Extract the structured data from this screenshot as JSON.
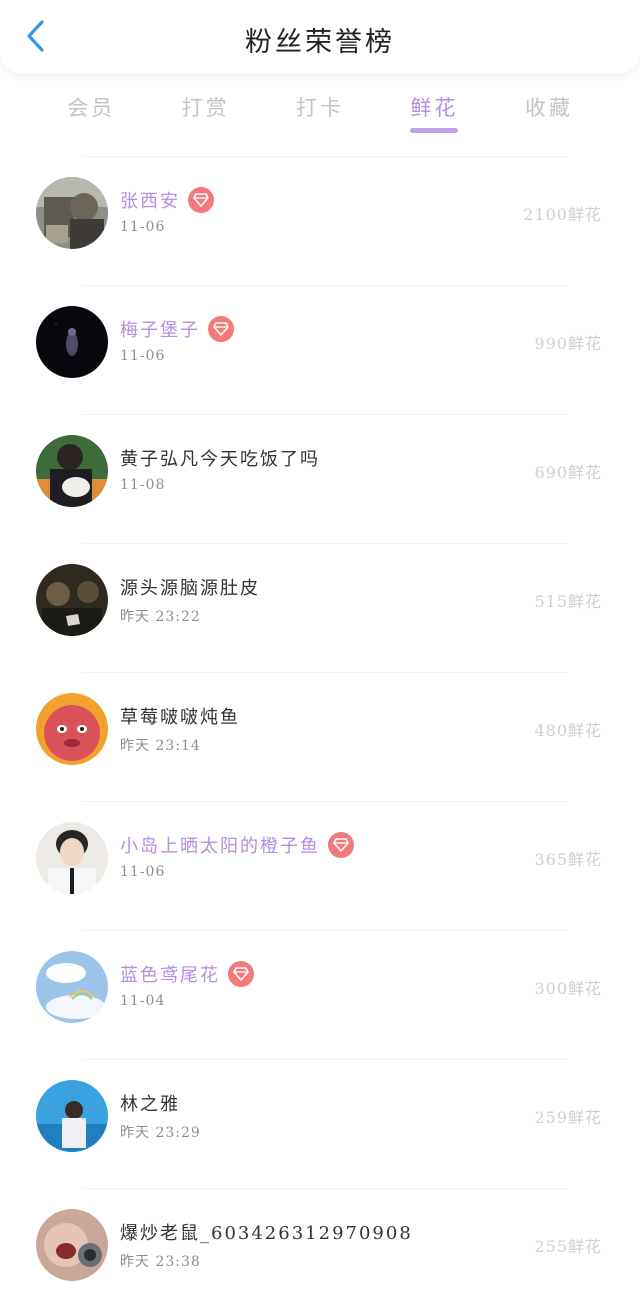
{
  "header": {
    "title": "粉丝荣誉榜",
    "back_icon": "chevron-left-icon",
    "accent_color": "#2f9be8"
  },
  "tabs": [
    {
      "label": "会员",
      "active": false
    },
    {
      "label": "打赏",
      "active": false
    },
    {
      "label": "打卡",
      "active": false
    },
    {
      "label": "鲜花",
      "active": true
    },
    {
      "label": "收藏",
      "active": false
    }
  ],
  "colors": {
    "active_tab": "#b48ee0",
    "vip_name": "#b48ee0",
    "badge": "#f27a7a",
    "amount": "#cfcfcf"
  },
  "rows": [
    {
      "name": "张西安",
      "time": "11-06",
      "amount": "2100鲜花",
      "vip": true,
      "avatar_icon": "user-avatar-photo"
    },
    {
      "name": "梅子堡子",
      "time": "11-06",
      "amount": "990鲜花",
      "vip": true,
      "avatar_icon": "user-avatar-photo"
    },
    {
      "name": "黄子弘凡今天吃饭了吗",
      "time": "11-08",
      "amount": "690鲜花",
      "vip": false,
      "avatar_icon": "user-avatar-photo"
    },
    {
      "name": "源头源脑源肚皮",
      "time": "昨天 23:22",
      "amount": "515鲜花",
      "vip": false,
      "avatar_icon": "user-avatar-photo"
    },
    {
      "name": "草莓啵啵炖鱼",
      "time": "昨天 23:14",
      "amount": "480鲜花",
      "vip": false,
      "avatar_icon": "user-avatar-photo"
    },
    {
      "name": "小岛上晒太阳的橙子鱼",
      "time": "11-06",
      "amount": "365鲜花",
      "vip": true,
      "avatar_icon": "user-avatar-photo"
    },
    {
      "name": "蓝色鸢尾花",
      "time": "11-04",
      "amount": "300鲜花",
      "vip": true,
      "avatar_icon": "user-avatar-photo"
    },
    {
      "name": "林之雅",
      "time": "昨天 23:29",
      "amount": "259鲜花",
      "vip": false,
      "avatar_icon": "user-avatar-photo"
    },
    {
      "name": "爆炒老鼠_603426312970908",
      "time": "昨天 23:38",
      "amount": "255鲜花",
      "vip": false,
      "avatar_icon": "user-avatar-photo"
    }
  ]
}
